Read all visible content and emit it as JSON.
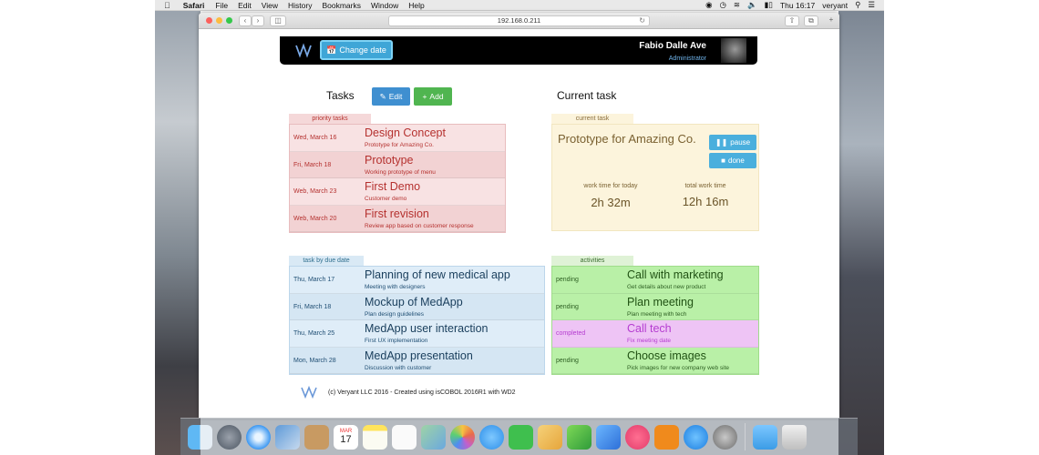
{
  "menubar": {
    "app": "Safari",
    "menus": [
      "File",
      "Edit",
      "View",
      "History",
      "Bookmarks",
      "Window",
      "Help"
    ],
    "clock": "Thu 16:17",
    "user": "veryant"
  },
  "browser": {
    "url": "192.168.0.211"
  },
  "header": {
    "change_date_label": "Change date",
    "user_name": "Fabio Dalle Ave",
    "user_role": "Administrator"
  },
  "tasks": {
    "title": "Tasks",
    "edit_label": "Edit",
    "add_label": "Add"
  },
  "priority": {
    "tab_label": "priority tasks",
    "rows": [
      {
        "date": "Wed, March 16",
        "title": "Design Concept",
        "desc": "Prototype for Amazing Co."
      },
      {
        "date": "Fri, March 18",
        "title": "Prototype",
        "desc": "Working prototype of menu"
      },
      {
        "date": "Web, March 23",
        "title": "First Demo",
        "desc": "Customer demo"
      },
      {
        "date": "Web, March 20",
        "title": "First revision",
        "desc": "Review app based on customer response"
      }
    ]
  },
  "current": {
    "title": "Current task",
    "tab_label": "current task",
    "task_name": "Prototype for Amazing Co.",
    "pause_label": "pause",
    "done_label": "done",
    "today_label": "work time for today",
    "today_value": "2h 32m",
    "total_label": "total work time",
    "total_value": "12h 16m"
  },
  "due": {
    "tab_label": "task by due date",
    "rows": [
      {
        "date": "Thu, March 17",
        "title": "Planning of new medical app",
        "desc": "Meeting with designers"
      },
      {
        "date": "Fri, March 18",
        "title": "Mockup of MedApp",
        "desc": "Plan design guidelines"
      },
      {
        "date": "Thu, March 25",
        "title": "MedApp user interaction",
        "desc": "First UX implementation"
      },
      {
        "date": "Mon, March 28",
        "title": "MedApp presentation",
        "desc": "Discussion with customer"
      }
    ]
  },
  "activities": {
    "tab_label": "activities",
    "rows": [
      {
        "status": "pending",
        "title": "Call with marketing",
        "desc": "Get details about new product"
      },
      {
        "status": "pending",
        "title": "Plan meeting",
        "desc": "Plan meeting with tech"
      },
      {
        "status": "completed",
        "title": "Call tech",
        "desc": "Fix meeting date"
      },
      {
        "status": "pending",
        "title": "Choose images",
        "desc": "Pick images for new company web site"
      }
    ]
  },
  "footer": {
    "text": "(c) Veryant LLC 2016 - Created using isCOBOL 2016R1 with WD2"
  },
  "dock": {
    "calendar_month": "MAR",
    "calendar_day": "17"
  },
  "colors": {
    "priority_bg": "#f5d8d9",
    "current_bg": "#fcf4dc",
    "due_bg": "#d9e9f5",
    "activity_pending": "#b9f0a7",
    "activity_completed": "#eec4f5",
    "button_blue": "#3f8fd0",
    "button_green": "#50b550",
    "accent_cyan": "#4aafdd"
  }
}
